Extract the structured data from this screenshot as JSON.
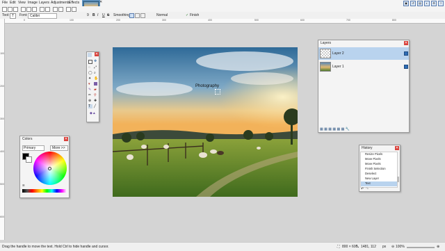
{
  "menu": [
    "File",
    "Edit",
    "View",
    "Image",
    "Layers",
    "Adjustments",
    "Effects"
  ],
  "toolbar": {
    "tool_label": "Tool:",
    "font_label": "Font:",
    "font_value": "Calibri",
    "font_size": "9",
    "antialias": "Smoothing",
    "blend": "Normal",
    "finish": "Finish"
  },
  "ruler_top": [
    "0",
    "100",
    "200",
    "300",
    "400",
    "500",
    "600",
    "700",
    "800"
  ],
  "ruler_left": [
    "100",
    "200",
    "300",
    "400",
    "500",
    "600"
  ],
  "canvas": {
    "text": "Photography"
  },
  "colors_panel": {
    "title": "Colors",
    "mode": "Primary",
    "more": "More >>"
  },
  "layers_panel": {
    "title": "Layers",
    "layers": [
      {
        "name": "Layer 2",
        "selected": true
      },
      {
        "name": "Layer 1",
        "selected": false
      }
    ]
  },
  "history_panel": {
    "title": "History",
    "items": [
      "Resize Pixels",
      "Move Pixels",
      "Move Pixels",
      "Finish Selection",
      "Deselect",
      "New Layer",
      "Text"
    ]
  },
  "status": {
    "hint": "Drag the handle to move the text. Hold Ctrl to hide handle and cursor.",
    "image_size": "800 × 600",
    "cursor_pos": "1481, 112",
    "units": "px",
    "zoom": "100%"
  },
  "colors": {
    "accent": "#4a7fc1",
    "selected_row": "#b9d3ee",
    "close": "#d9413b"
  }
}
